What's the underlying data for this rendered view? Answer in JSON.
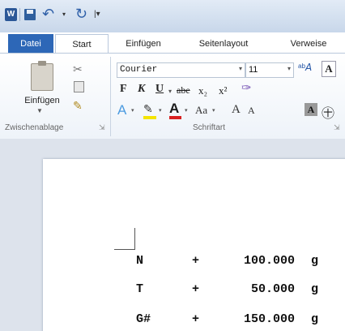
{
  "quick_access": {
    "app_icon": "W"
  },
  "tabs": [
    "Datei",
    "Start",
    "Einfügen",
    "Seitenlayout",
    "Verweise"
  ],
  "clipboard": {
    "paste_label": "Einfügen",
    "group_label": "Zwischenablage"
  },
  "font": {
    "font_name": "Courier",
    "font_size": "11",
    "group_label": "Schriftart",
    "bold_label": "F",
    "italic_label": "K",
    "underline_label": "U",
    "strike_label": "abe",
    "subscript_label": "x₂",
    "superscript_label": "x²",
    "case_label": "Aa",
    "grow_label": "A",
    "shrink_label": "A",
    "shading_label": "A",
    "font_color_label": "A",
    "text_effect_label": "A",
    "clear_format_label": "A",
    "enclose_label": "㊉"
  },
  "document": {
    "rows": [
      {
        "label": "N",
        "sign": "+",
        "value": "100.000",
        "unit": "g"
      },
      {
        "label": "T",
        "sign": "+",
        "value": "50.000",
        "unit": "g"
      },
      {
        "label": "G#",
        "sign": "+",
        "value": "150.000",
        "unit": "g"
      }
    ]
  },
  "colors": {
    "file_tab": "#2d67b7",
    "highlight": "#f4e400",
    "font_color": "#d82020"
  }
}
